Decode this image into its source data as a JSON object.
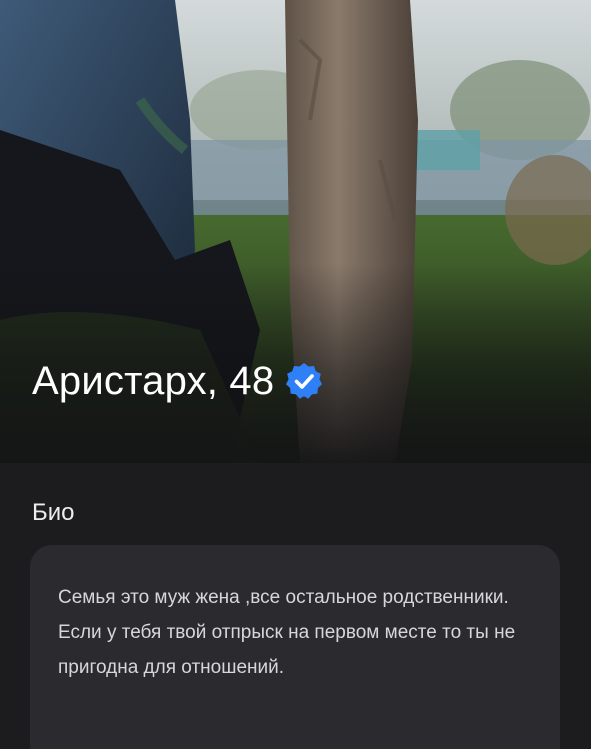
{
  "profile": {
    "name_age": "Аристарх, 48",
    "verified_icon": "verified-badge-icon",
    "verified_color": "#2f7ff6"
  },
  "bio": {
    "title": "Био",
    "text": "Семья это муж жена ,все остальное родственники. Если у тебя твой отпрыск на первом месте то ты не пригодна для отношений."
  },
  "colors": {
    "background": "#1c1c1f",
    "card": "#2b2b2f",
    "text_primary": "#ffffff",
    "text_secondary": "#d7d7da"
  }
}
